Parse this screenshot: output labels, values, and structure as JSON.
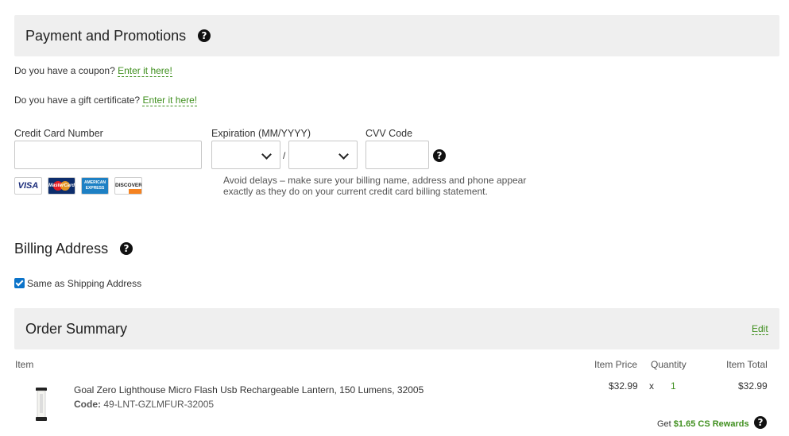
{
  "payment": {
    "title": "Payment and Promotions",
    "coupon_text": "Do you have a coupon?",
    "coupon_link": "Enter it here!",
    "gift_text": "Do you have a gift certificate?",
    "gift_link": "Enter it here!",
    "cc_label": "Credit Card Number",
    "cc_value": "",
    "exp_label": "Expiration (MM/YYYY)",
    "exp_month": "",
    "exp_year": "",
    "exp_separator": "/",
    "cvv_label": "CVV Code",
    "cvv_value": "",
    "cards": {
      "visa": "VISA",
      "mastercard": "MasterCard",
      "amex": "AMERICAN EXPRESS",
      "discover": "DISCOVER"
    },
    "note": "Avoid delays – make sure your billing name, address and phone appear exactly as they do on your current credit card billing statement."
  },
  "billing": {
    "title": "Billing Address",
    "same_as_shipping_label": "Same as Shipping Address",
    "same_as_shipping_checked": true
  },
  "order_summary": {
    "title": "Order Summary",
    "edit_link": "Edit",
    "columns": {
      "item": "Item",
      "price": "Item Price",
      "quantity": "Quantity",
      "total": "Item Total"
    },
    "items": [
      {
        "name": "Goal Zero Lighthouse Micro Flash Usb Rechargeable Lantern, 150 Lumens, 32005",
        "code_label": "Code:",
        "code": "49-LNT-GZLMFUR-32005",
        "price": "$32.99",
        "times": "x",
        "quantity": "1",
        "total": "$32.99",
        "rewards_prefix": "Get",
        "rewards_value": "$1.65 CS Rewards"
      }
    ]
  },
  "colors": {
    "accent_green": "#3f8f1e",
    "header_bg": "#efefef",
    "checkbox_blue": "#0b73c9"
  }
}
